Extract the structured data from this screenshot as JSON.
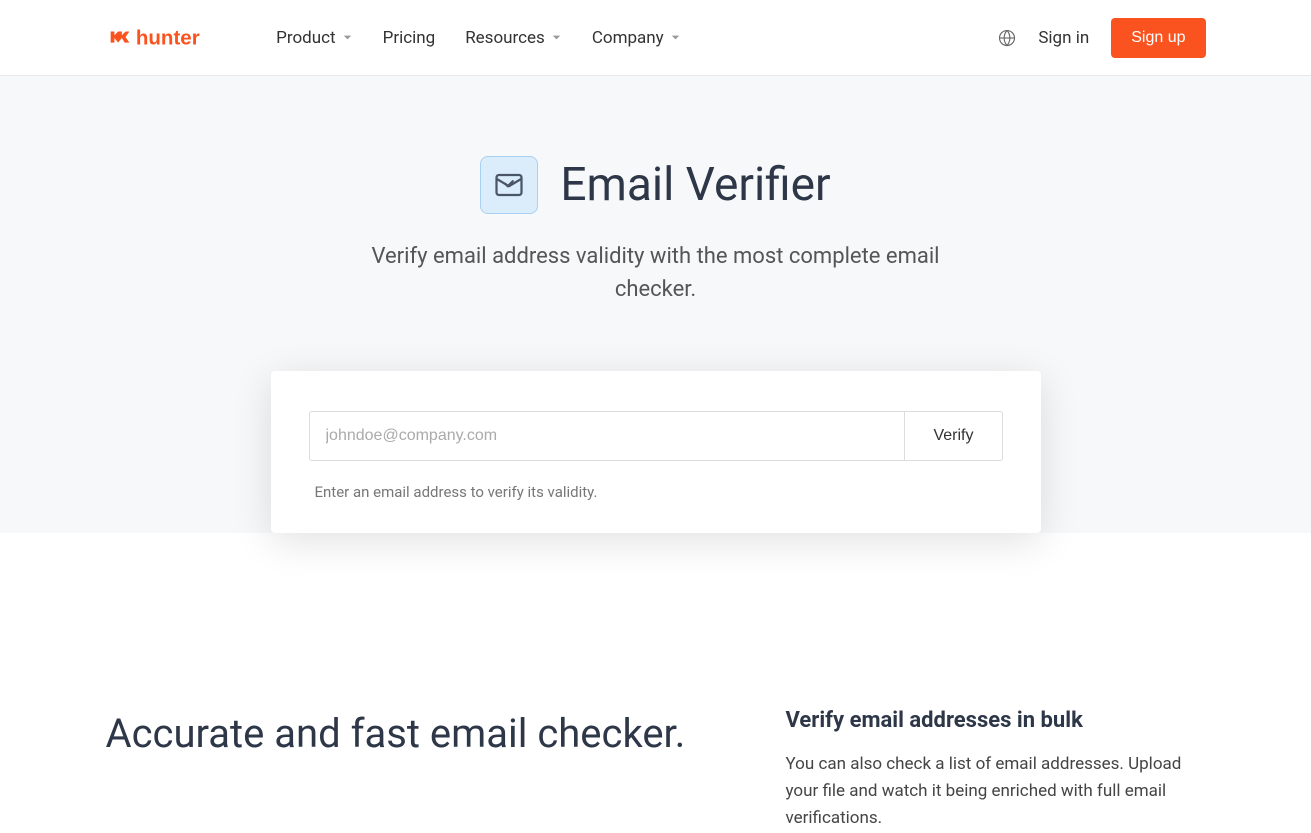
{
  "header": {
    "logo_text": "hunter",
    "nav": {
      "product": "Product",
      "pricing": "Pricing",
      "resources": "Resources",
      "company": "Company"
    },
    "signin": "Sign in",
    "signup": "Sign up"
  },
  "hero": {
    "title": "Email Verifier",
    "subtitle": "Verify email address validity with the most complete email checker."
  },
  "verifier": {
    "placeholder": "johndoe@company.com",
    "button": "Verify",
    "hint": "Enter an email address to verify its validity."
  },
  "content": {
    "heading": "Accurate and fast email checker.",
    "bulk_heading": "Verify email addresses in bulk",
    "bulk_text": "You can also check a list of email addresses. Upload your file and watch it being enriched with full email verifications."
  }
}
